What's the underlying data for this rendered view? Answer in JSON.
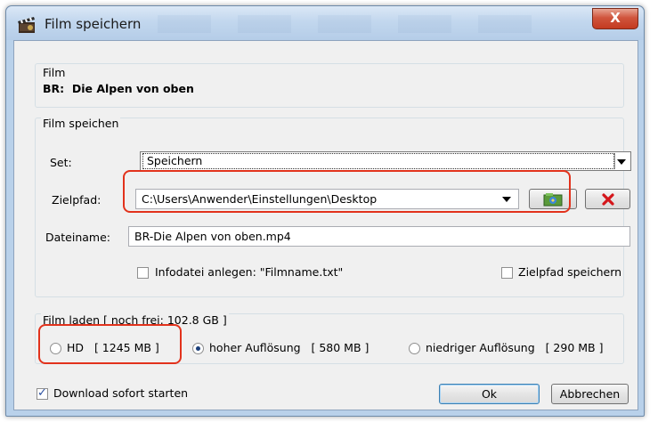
{
  "window": {
    "title": "Film speichern",
    "close_glyph": "X"
  },
  "film_group": {
    "label": "Film",
    "name": "BR:  Die Alpen von oben"
  },
  "save_group": {
    "label": "Film speichen",
    "set_label": "Set:",
    "set_value": "Speichern",
    "path_label": "Zielpfad:",
    "path_value": "C:\\Users\\Anwender\\Einstellungen\\Desktop",
    "filename_label": "Dateiname:",
    "filename_value": "BR-Die Alpen von oben.mp4",
    "infofile_label": "Infodatei anlegen: \"Filmname.txt\"",
    "infofile_checked": false,
    "save_path_label": "Zielpfad speichern",
    "save_path_checked": false
  },
  "load_group": {
    "label": "Film laden [ noch frei: 102.8 GB ]",
    "options": [
      {
        "label": "HD   [ 1245 MB ]",
        "selected": false
      },
      {
        "label": "hoher Auflösung   [ 580 MB ]",
        "selected": true
      },
      {
        "label": "niedriger Auflösung   [ 290 MB ]",
        "selected": false
      }
    ]
  },
  "footer": {
    "download_label": "Download sofort starten",
    "download_checked": true,
    "ok_label": "Ok",
    "cancel_label": "Abbrechen"
  },
  "colors": {
    "highlight": "#e2321c",
    "delete_icon": "#d4161b"
  },
  "icons": [
    "film-clapper-icon",
    "close-icon",
    "folder-browse-icon",
    "delete-x-icon",
    "dropdown-arrow-icon"
  ]
}
